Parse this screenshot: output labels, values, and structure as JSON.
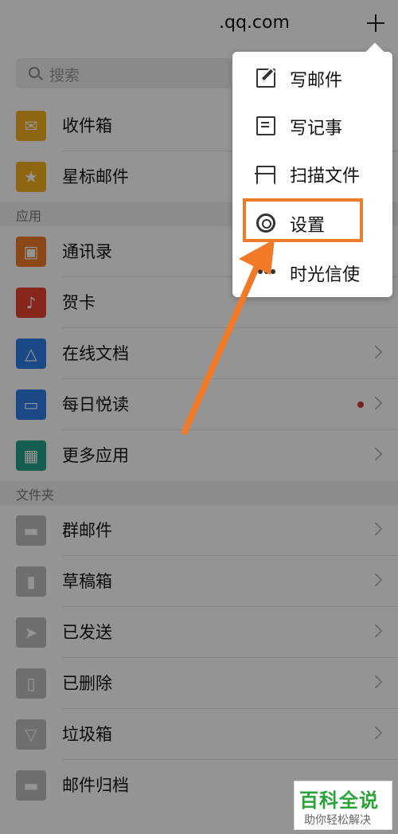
{
  "header": {
    "title": ".qq.com"
  },
  "search": {
    "placeholder": "搜索"
  },
  "top_items": [
    {
      "label": "收件箱",
      "icon": "envelope-icon",
      "color": "#f2b01e"
    },
    {
      "label": "星标邮件",
      "icon": "star-icon",
      "color": "#f2b01e"
    }
  ],
  "sections": {
    "apps": "应用",
    "folders": "文件夹"
  },
  "apps": [
    {
      "label": "通讯录",
      "icon": "contact-card-icon",
      "color": "#f07a28"
    },
    {
      "label": "贺卡",
      "icon": "greeting-card-icon",
      "color": "#e8422f"
    },
    {
      "label": "在线文档",
      "icon": "document-share-icon",
      "color": "#2f7ee8"
    },
    {
      "label": "每日悦读",
      "icon": "reader-icon",
      "color": "#2f7ee8",
      "has_dot": true
    },
    {
      "label": "更多应用",
      "icon": "grid-icon",
      "color": "#23a08b"
    }
  ],
  "folders": [
    {
      "label": "群邮件",
      "icon": "folder-icon"
    },
    {
      "label": "草稿箱",
      "icon": "draft-icon"
    },
    {
      "label": "已发送",
      "icon": "send-icon"
    },
    {
      "label": "已删除",
      "icon": "trash-icon"
    },
    {
      "label": "垃圾箱",
      "icon": "spam-bin-icon"
    },
    {
      "label": "邮件归档",
      "icon": "archive-folder-icon"
    }
  ],
  "menu": {
    "items": [
      {
        "label": "写邮件",
        "icon": "edit-icon"
      },
      {
        "label": "写记事",
        "icon": "note-icon"
      },
      {
        "label": "扫描文件",
        "icon": "scan-icon"
      },
      {
        "label": "设置",
        "icon": "gear-icon"
      },
      {
        "label": "时光信使",
        "icon": "dots-icon"
      }
    ]
  },
  "annotation": {
    "highlight_color": "#f07a28",
    "arrow_color": "#f07a28"
  },
  "watermark": {
    "title": "百科全说",
    "subtitle": "助你轻松解决"
  }
}
